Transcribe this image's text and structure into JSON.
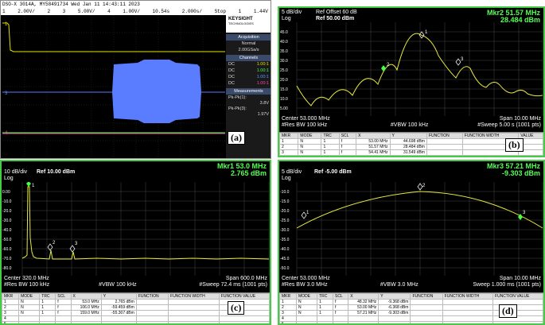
{
  "panel_a": {
    "status_line": "DSO-X 3014A, MY58491734  Wed Jan 11 14:43:11 2023",
    "toolbar": [
      "1",
      "2.00V/",
      "2",
      "3",
      "5.00V/",
      "4",
      "1.00V/",
      "10.54s",
      "2.000s/",
      "Stop",
      "1",
      "1.44V"
    ],
    "brand": "KEYSIGHT",
    "brand_sub": "TECHNOLOGIES",
    "acq_header": "Acquisition",
    "acq_mode": "Normal",
    "acq_rate": "2.00GSa/s",
    "channels_header": "Channels",
    "channels": [
      {
        "coupling": "DC",
        "value": "1.00:1"
      },
      {
        "coupling": "DC",
        "value": "1.00:1"
      },
      {
        "coupling": "DC",
        "value": "1.00:1"
      },
      {
        "coupling": "DC",
        "value": "1.00:1"
      }
    ],
    "meas_header": "Measurements",
    "meas": [
      {
        "label": "Pk-Pk(1):",
        "value": "3.8V"
      },
      {
        "label": "Pk-Pk(3):",
        "value": "1.97V"
      }
    ],
    "label": "(a)",
    "colors": {
      "ch1": "#e0e000",
      "ch2": "#44ff44",
      "ch3": "#5a7dff",
      "ch4": "#ff44aa"
    }
  },
  "panel_b": {
    "scale": "5 dB/div",
    "log": "Log",
    "ref_offset": "Ref Offset 60 dB",
    "ref": "Ref 50.00 dBm",
    "marker_title": "Mkr2 51.57 MHz",
    "marker_value": "28.484 dBm",
    "y_ticks": [
      "45.0",
      "40.0",
      "35.0",
      "30.0",
      "25.0",
      "20.0",
      "15.0",
      "10.0",
      "5.00"
    ],
    "center": "Center 53.000 MHz",
    "span": "Span 10.00 MHz",
    "res_bw": "#Res BW 100 kHz",
    "vbw": "#VBW 100 kHz",
    "sweep": "#Sweep  5.00 s (1001 pts)",
    "table_headers": [
      "MKR",
      "MODE",
      "TRC",
      "SCL",
      "X",
      "Y",
      "FUNCTION",
      "FUNCTION WIDTH",
      "VALUE"
    ],
    "table_rows": [
      [
        "1",
        "N",
        "1",
        "f",
        "53.00 MHz",
        "44.698 dBm"
      ],
      [
        "2",
        "N",
        "1",
        "f",
        "51.57 MHz",
        "28.484 dBm"
      ],
      [
        "3",
        "N",
        "1",
        "f",
        "54.41 MHz",
        "31.549 dBm"
      ]
    ],
    "label": "(b)"
  },
  "panel_c": {
    "scale": "10 dB/div",
    "log": "Log",
    "ref": "Ref 10.00 dBm",
    "marker_title": "Mkr1 53.0 MHz",
    "marker_value": "2.765 dBm",
    "y_ticks": [
      "0.00",
      "-10.0",
      "-20.0",
      "-30.0",
      "-40.0",
      "-50.0",
      "-60.0",
      "-70.0",
      "-80.0"
    ],
    "center": "Center 320.0 MHz",
    "span": "Span 600.0 MHz",
    "res_bw": "#Res BW 100 kHz",
    "vbw": "#VBW 100 kHz",
    "sweep": "#Sweep  72.4 ms (1001 pts)",
    "table_headers": [
      "MKR",
      "MODE",
      "TRC",
      "SCL",
      "X",
      "Y",
      "FUNCTION",
      "FUNCTION WIDTH",
      "FUNCTION VALUE"
    ],
    "table_rows": [
      [
        "1",
        "N",
        "1",
        "f",
        "53.0 MHz",
        "2.765 dBm"
      ],
      [
        "2",
        "N",
        "1",
        "f",
        "106.0 MHz",
        "-59.459 dBm"
      ],
      [
        "3",
        "N",
        "1",
        "f",
        "159.0 MHz",
        "-55.307 dBm"
      ],
      [
        "4",
        "",
        "",
        "",
        "",
        ""
      ],
      [
        "5",
        "",
        "",
        "",
        "",
        ""
      ]
    ],
    "label": "(c)"
  },
  "panel_d": {
    "scale": "5 dB/div",
    "log": "Log",
    "ref": "Ref -5.00 dBm",
    "marker_title": "Mkr3 57.21 MHz",
    "marker_value": "-9.303 dBm",
    "y_ticks": [
      "-10.0",
      "-15.0",
      "-20.0",
      "-25.0",
      "-30.0",
      "-35.0",
      "-40.0",
      "-45.0",
      "-50.0"
    ],
    "center": "Center 53.000 MHz",
    "span": "Span 10.00 MHz",
    "res_bw": "#Res BW 3.0 MHz",
    "vbw": "#VBW 3.0 MHz",
    "sweep": "Sweep  1.000 ms (1001 pts)",
    "table_headers": [
      "MKR",
      "MODE",
      "TRC",
      "SCL",
      "X",
      "Y",
      "FUNCTION",
      "FUNCTION WIDTH",
      "FUNCTION VALUE"
    ],
    "table_rows": [
      [
        "1",
        "N",
        "1",
        "f",
        "48.32 MHz",
        "-9.368 dBm"
      ],
      [
        "2",
        "N",
        "1",
        "f",
        "53.00 MHz",
        "-6.368 dBm"
      ],
      [
        "3",
        "N",
        "1",
        "f",
        "57.21 MHz",
        "-9.303 dBm"
      ],
      [
        "4",
        "",
        "",
        "",
        "",
        ""
      ],
      [
        "5",
        "",
        "",
        "",
        "",
        ""
      ]
    ],
    "label": "(d)"
  }
}
